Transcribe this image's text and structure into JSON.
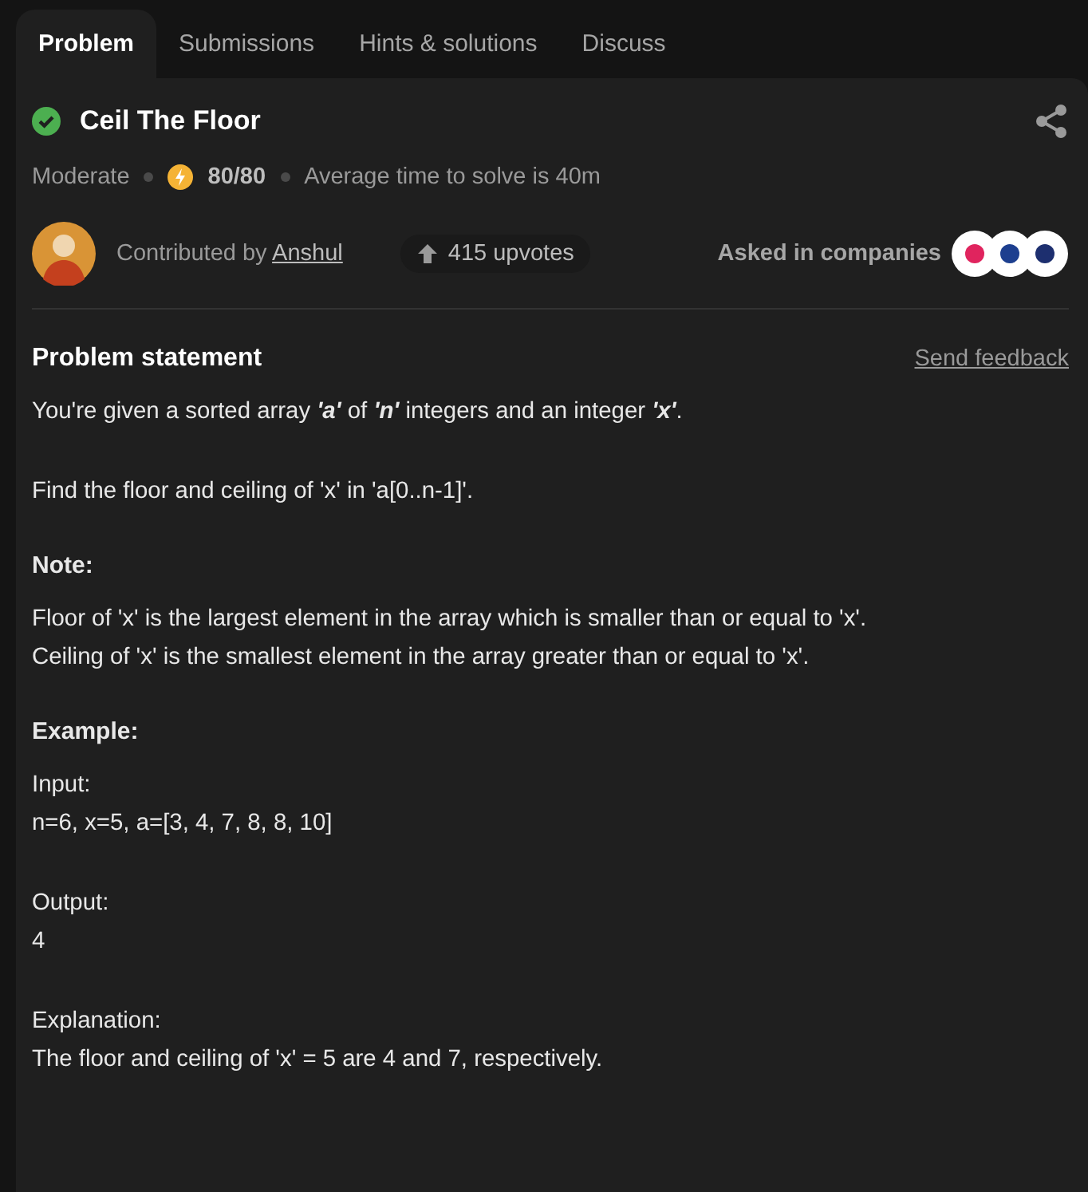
{
  "tabs": [
    {
      "label": "Problem",
      "selected": true
    },
    {
      "label": "Submissions",
      "selected": false
    },
    {
      "label": "Hints & solutions",
      "selected": false
    },
    {
      "label": "Discuss",
      "selected": false
    }
  ],
  "problem": {
    "title": "Ceil The Floor",
    "solved": true,
    "difficulty": "Moderate",
    "score": "80/80",
    "average_time": "Average time to solve is 40m"
  },
  "contributor": {
    "prefix": "Contributed by",
    "name": "Anshul"
  },
  "upvotes": "415 upvotes",
  "companies": {
    "label": "Asked in companies",
    "logos": [
      {
        "color": "#e0245e"
      },
      {
        "color": "#1d3f8f"
      },
      {
        "color": "#1d2f6f"
      }
    ]
  },
  "statement": {
    "heading": "Problem statement",
    "feedback_link": "Send feedback",
    "blocks": [
      {
        "kind": "paragraph",
        "lines": [
          "You're given a sorted array **'a'** of **'n'** integers and an integer **'x'**."
        ]
      },
      {
        "kind": "paragraph",
        "lines": [
          "Find the floor and ceiling of 'x' in 'a[0..n-1]'."
        ]
      },
      {
        "kind": "heading",
        "text": "Note:"
      },
      {
        "kind": "paragraph",
        "lines": [
          "Floor of 'x' is the largest element in the array which is smaller than or equal to 'x'.",
          "Ceiling of 'x' is the smallest element in the array greater than or equal to 'x'."
        ]
      },
      {
        "kind": "heading",
        "text": "Example:"
      },
      {
        "kind": "paragraph",
        "lines": [
          "Input:",
          "n=6, x=5, a=[3, 4, 7, 8, 8, 10]"
        ]
      },
      {
        "kind": "paragraph",
        "lines": [
          "Output:",
          "4"
        ]
      },
      {
        "kind": "paragraph",
        "lines": [
          "Explanation:",
          "The floor and ceiling of 'x' = 5 are 4 and 7, respectively."
        ]
      }
    ]
  }
}
